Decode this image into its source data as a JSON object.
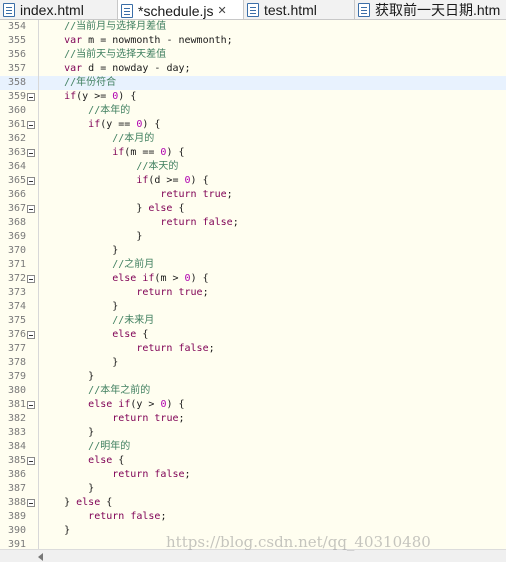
{
  "tabs": [
    {
      "label": "index.html",
      "active": false,
      "closable": false
    },
    {
      "label": "*schedule.js",
      "active": true,
      "closable": true
    },
    {
      "label": "test.html",
      "active": false,
      "closable": false
    },
    {
      "label": "获取前一天日期.htm",
      "active": false,
      "closable": false
    }
  ],
  "editor": {
    "current_line": 358,
    "lines": [
      {
        "n": "354",
        "fold": false,
        "indent": 4,
        "parts": [
          {
            "t": "//当前月与选择月差值",
            "c": "cm"
          }
        ]
      },
      {
        "n": "355",
        "fold": false,
        "indent": 4,
        "parts": [
          {
            "t": "var",
            "c": "kw"
          },
          {
            "t": " m = nowmonth - newmonth;",
            "c": ""
          }
        ]
      },
      {
        "n": "356",
        "fold": false,
        "indent": 4,
        "parts": [
          {
            "t": "//当前天与选择天差值",
            "c": "cm"
          }
        ]
      },
      {
        "n": "357",
        "fold": false,
        "indent": 4,
        "parts": [
          {
            "t": "var",
            "c": "kw"
          },
          {
            "t": " d = nowday - day;",
            "c": ""
          }
        ]
      },
      {
        "n": "358",
        "fold": false,
        "indent": 4,
        "parts": [
          {
            "t": "//年份符合",
            "c": "cm"
          }
        ]
      },
      {
        "n": "359",
        "fold": true,
        "indent": 4,
        "parts": [
          {
            "t": "if",
            "c": "kw"
          },
          {
            "t": "(y >= ",
            "c": ""
          },
          {
            "t": "0",
            "c": "num"
          },
          {
            "t": ") {",
            "c": ""
          }
        ]
      },
      {
        "n": "360",
        "fold": false,
        "indent": 8,
        "parts": [
          {
            "t": "//本年的",
            "c": "cm"
          }
        ]
      },
      {
        "n": "361",
        "fold": true,
        "indent": 8,
        "parts": [
          {
            "t": "if",
            "c": "kw"
          },
          {
            "t": "(y == ",
            "c": ""
          },
          {
            "t": "0",
            "c": "num"
          },
          {
            "t": ") {",
            "c": ""
          }
        ]
      },
      {
        "n": "362",
        "fold": false,
        "indent": 12,
        "parts": [
          {
            "t": "//本月的",
            "c": "cm"
          }
        ]
      },
      {
        "n": "363",
        "fold": true,
        "indent": 12,
        "parts": [
          {
            "t": "if",
            "c": "kw"
          },
          {
            "t": "(m == ",
            "c": ""
          },
          {
            "t": "0",
            "c": "num"
          },
          {
            "t": ") {",
            "c": ""
          }
        ]
      },
      {
        "n": "364",
        "fold": false,
        "indent": 16,
        "parts": [
          {
            "t": "//本天的",
            "c": "cm"
          }
        ]
      },
      {
        "n": "365",
        "fold": true,
        "indent": 16,
        "parts": [
          {
            "t": "if",
            "c": "kw"
          },
          {
            "t": "(d >= ",
            "c": ""
          },
          {
            "t": "0",
            "c": "num"
          },
          {
            "t": ") {",
            "c": ""
          }
        ]
      },
      {
        "n": "366",
        "fold": false,
        "indent": 20,
        "parts": [
          {
            "t": "return",
            "c": "kw"
          },
          {
            "t": " ",
            "c": ""
          },
          {
            "t": "true",
            "c": "kw"
          },
          {
            "t": ";",
            "c": ""
          }
        ]
      },
      {
        "n": "367",
        "fold": true,
        "indent": 16,
        "parts": [
          {
            "t": "} ",
            "c": ""
          },
          {
            "t": "else",
            "c": "kw"
          },
          {
            "t": " {",
            "c": ""
          }
        ]
      },
      {
        "n": "368",
        "fold": false,
        "indent": 20,
        "parts": [
          {
            "t": "return",
            "c": "kw"
          },
          {
            "t": " ",
            "c": ""
          },
          {
            "t": "false",
            "c": "kw"
          },
          {
            "t": ";",
            "c": ""
          }
        ]
      },
      {
        "n": "369",
        "fold": false,
        "indent": 16,
        "parts": [
          {
            "t": "}",
            "c": ""
          }
        ]
      },
      {
        "n": "370",
        "fold": false,
        "indent": 12,
        "parts": [
          {
            "t": "}",
            "c": ""
          }
        ]
      },
      {
        "n": "371",
        "fold": false,
        "indent": 12,
        "parts": [
          {
            "t": "//之前月",
            "c": "cm"
          }
        ]
      },
      {
        "n": "372",
        "fold": true,
        "indent": 12,
        "parts": [
          {
            "t": "else",
            "c": "kw"
          },
          {
            "t": " ",
            "c": ""
          },
          {
            "t": "if",
            "c": "kw"
          },
          {
            "t": "(m > ",
            "c": ""
          },
          {
            "t": "0",
            "c": "num"
          },
          {
            "t": ") {",
            "c": ""
          }
        ]
      },
      {
        "n": "373",
        "fold": false,
        "indent": 16,
        "parts": [
          {
            "t": "return",
            "c": "kw"
          },
          {
            "t": " ",
            "c": ""
          },
          {
            "t": "true",
            "c": "kw"
          },
          {
            "t": ";",
            "c": ""
          }
        ]
      },
      {
        "n": "374",
        "fold": false,
        "indent": 12,
        "parts": [
          {
            "t": "}",
            "c": ""
          }
        ]
      },
      {
        "n": "375",
        "fold": false,
        "indent": 12,
        "parts": [
          {
            "t": "//未来月",
            "c": "cm"
          }
        ]
      },
      {
        "n": "376",
        "fold": true,
        "indent": 12,
        "parts": [
          {
            "t": "else",
            "c": "kw"
          },
          {
            "t": " {",
            "c": ""
          }
        ]
      },
      {
        "n": "377",
        "fold": false,
        "indent": 16,
        "parts": [
          {
            "t": "return",
            "c": "kw"
          },
          {
            "t": " ",
            "c": ""
          },
          {
            "t": "false",
            "c": "kw"
          },
          {
            "t": ";",
            "c": ""
          }
        ]
      },
      {
        "n": "378",
        "fold": false,
        "indent": 12,
        "parts": [
          {
            "t": "}",
            "c": ""
          }
        ]
      },
      {
        "n": "379",
        "fold": false,
        "indent": 8,
        "parts": [
          {
            "t": "}",
            "c": ""
          }
        ]
      },
      {
        "n": "380",
        "fold": false,
        "indent": 8,
        "parts": [
          {
            "t": "//本年之前的",
            "c": "cm"
          }
        ]
      },
      {
        "n": "381",
        "fold": true,
        "indent": 8,
        "parts": [
          {
            "t": "else",
            "c": "kw"
          },
          {
            "t": " ",
            "c": ""
          },
          {
            "t": "if",
            "c": "kw"
          },
          {
            "t": "(y > ",
            "c": ""
          },
          {
            "t": "0",
            "c": "num"
          },
          {
            "t": ") {",
            "c": ""
          }
        ]
      },
      {
        "n": "382",
        "fold": false,
        "indent": 12,
        "parts": [
          {
            "t": "return",
            "c": "kw"
          },
          {
            "t": " ",
            "c": ""
          },
          {
            "t": "true",
            "c": "kw"
          },
          {
            "t": ";",
            "c": ""
          }
        ]
      },
      {
        "n": "383",
        "fold": false,
        "indent": 8,
        "parts": [
          {
            "t": "}",
            "c": ""
          }
        ]
      },
      {
        "n": "384",
        "fold": false,
        "indent": 8,
        "parts": [
          {
            "t": "//明年的",
            "c": "cm"
          }
        ]
      },
      {
        "n": "385",
        "fold": true,
        "indent": 8,
        "parts": [
          {
            "t": "else",
            "c": "kw"
          },
          {
            "t": " {",
            "c": ""
          }
        ]
      },
      {
        "n": "386",
        "fold": false,
        "indent": 12,
        "parts": [
          {
            "t": "return",
            "c": "kw"
          },
          {
            "t": " ",
            "c": ""
          },
          {
            "t": "false",
            "c": "kw"
          },
          {
            "t": ";",
            "c": ""
          }
        ]
      },
      {
        "n": "387",
        "fold": false,
        "indent": 8,
        "parts": [
          {
            "t": "}",
            "c": ""
          }
        ]
      },
      {
        "n": "388",
        "fold": true,
        "indent": 4,
        "parts": [
          {
            "t": "} ",
            "c": ""
          },
          {
            "t": "else",
            "c": "kw"
          },
          {
            "t": " {",
            "c": ""
          }
        ]
      },
      {
        "n": "389",
        "fold": false,
        "indent": 8,
        "parts": [
          {
            "t": "return",
            "c": "kw"
          },
          {
            "t": " ",
            "c": ""
          },
          {
            "t": "false",
            "c": "kw"
          },
          {
            "t": ";",
            "c": ""
          }
        ]
      },
      {
        "n": "390",
        "fold": false,
        "indent": 4,
        "parts": [
          {
            "t": "}",
            "c": ""
          }
        ]
      },
      {
        "n": "391",
        "fold": false,
        "indent": 0,
        "parts": []
      }
    ]
  },
  "watermark": "https://blog.csdn.net/qq_40310480",
  "colors": {
    "comment": "#3f7f5f",
    "keyword": "#7f0055",
    "number": "#b000b0",
    "current_line": "#e8f2fe",
    "background": "#fffef0"
  }
}
